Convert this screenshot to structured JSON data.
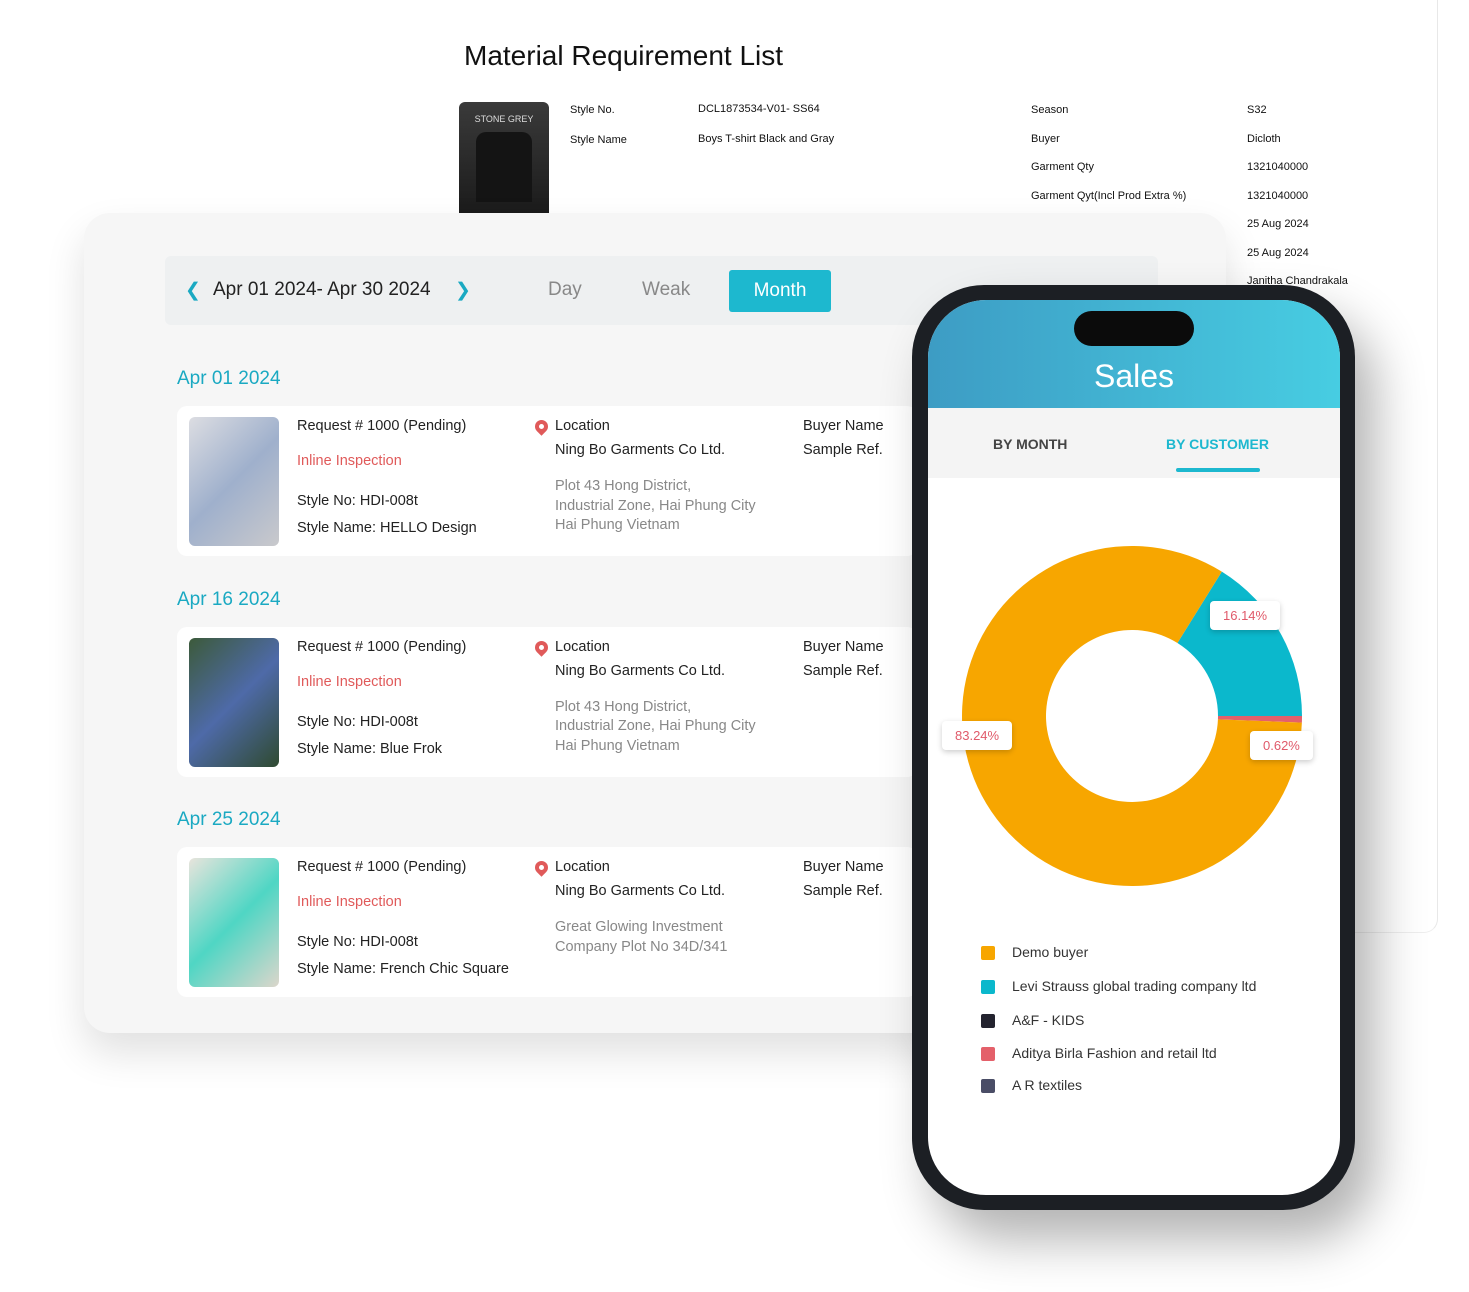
{
  "document": {
    "title": "Material Requirement List",
    "thumb_label": "STONE GREY",
    "left_fields": [
      {
        "label": "Style No.",
        "value": "DCL1873534-V01- SS64"
      },
      {
        "label": "Style Name",
        "value": "Boys T-shirt Black and Gray"
      }
    ],
    "right_fields": [
      {
        "label": "Season",
        "value": "S32"
      },
      {
        "label": "Buyer",
        "value": "Dicloth"
      },
      {
        "label": "Garment Qty",
        "value": "1321040000"
      },
      {
        "label": "Garment Qyt(Incl Prod Extra %)",
        "value": "1321040000"
      },
      {
        "label": "",
        "value": "25 Aug 2024"
      },
      {
        "label": "",
        "value": "25 Aug 2024"
      },
      {
        "label": "",
        "value": "Janitha Chandrakala"
      }
    ]
  },
  "calendar": {
    "range": "Apr 01 2024- Apr 30 2024",
    "views": [
      "Day",
      "Weak",
      "Month"
    ],
    "active_view": "Month",
    "accent": "#1db8cf",
    "groups": [
      {
        "date": "Apr 01 2024",
        "request": "Request # 1000 (Pending)",
        "type": "Inline Inspection",
        "style_no": "Style No: HDI-008t",
        "style_name": "Style Name: HELLO Design",
        "location_label": "Location",
        "company": "Ning Bo Garments Co Ltd.",
        "address": [
          "Plot 43 Hong District,",
          "Industrial Zone, Hai Phung City",
          "Hai Phung Vietnam"
        ],
        "buyer": "Buyer Name",
        "sample": "Sample Ref."
      },
      {
        "date": "Apr 16 2024",
        "request": "Request # 1000 (Pending)",
        "type": "Inline Inspection",
        "style_no": "Style No: HDI-008t",
        "style_name": "Style Name: Blue Frok",
        "location_label": "Location",
        "company": "Ning Bo Garments Co Ltd.",
        "address": [
          "Plot 43 Hong District,",
          "Industrial Zone, Hai Phung City",
          "Hai Phung Vietnam"
        ],
        "buyer": "Buyer Name",
        "sample": "Sample Ref."
      },
      {
        "date": "Apr 25 2024",
        "request": "Request # 1000 (Pending)",
        "type": "Inline Inspection",
        "style_no": "Style No: HDI-008t",
        "style_name": "Style Name: French Chic Square",
        "location_label": "Location",
        "company": "Ning Bo Garments Co Ltd.",
        "address": [
          "Great Glowing Investment",
          "Company Plot No 34D/341"
        ],
        "buyer": "Buyer Name",
        "sample": "Sample Ref."
      }
    ]
  },
  "phone": {
    "title": "Sales",
    "tabs": [
      "BY MONTH",
      "BY CUSTOMER"
    ],
    "active_tab": "BY CUSTOMER"
  },
  "chart_data": {
    "type": "pie",
    "donut": true,
    "categories": [
      "Demo buyer",
      "Levi Strauss global trading company ltd",
      "A&F - KIDS",
      "Aditya Birla Fashion and retail ltd",
      "A R textiles"
    ],
    "colors": [
      "#f7a600",
      "#0bb8cc",
      "#23232f",
      "#e4606a",
      "#4a4d66"
    ],
    "slices": [
      {
        "name": "Demo buyer",
        "value": 83.24,
        "label": "83.24%"
      },
      {
        "name": "Levi Strauss global trading company ltd",
        "value": 16.14,
        "label": "16.14%"
      },
      {
        "name": "Aditya Birla Fashion and retail ltd",
        "value": 0.62,
        "label": "0.62%"
      }
    ],
    "legend_placement": "bottom"
  }
}
